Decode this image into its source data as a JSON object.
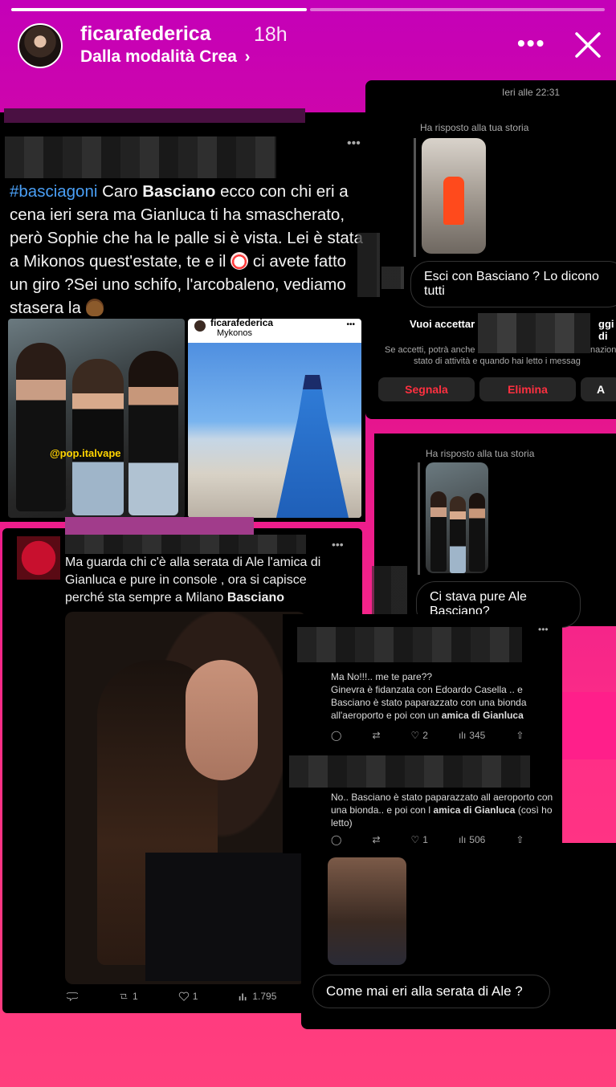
{
  "story": {
    "username": "ficarafederica",
    "time": "18h",
    "subtitle": "Dalla modalità Crea",
    "progress": [
      1.0,
      0.0
    ]
  },
  "dm1": {
    "timestamp": "Ieri alle 22:31",
    "reply_label": "Ha risposto alla tua storia",
    "message": "Esci con Basciano ? Lo dicono tutti",
    "request_title": "Vuoi accettar",
    "request_title_tail": "ggi di",
    "request_line1": "Se accetti, potrà anche",
    "request_line1_tail": "nazione",
    "request_line2": "stato di attività e quando hai letto i messag",
    "report_btn": "Segnala",
    "delete_btn": "Elimina",
    "accept_btn": "A"
  },
  "tweet1": {
    "hashtag": "#basciagoni",
    "text_a": " Caro ",
    "bold1": "Basciano",
    "text_b": " ecco con chi eri a cena ieri sera ma Gianluca ti ha smascherato, però Sophie che ha le palle si è vista. Lei è stata a Mikonos quest'estate, te e il ",
    "text_c": " ci avete fatto un giro ?Sei uno schifo, l'arcobaleno, vediamo stasera la ",
    "watermark": "@pop.italvape",
    "insta_user": "ficarafederica",
    "insta_place": "Mykonos"
  },
  "dm2": {
    "reply_label": "Ha risposto alla tua storia",
    "message": "Ci stava pure Ale Basciano?"
  },
  "tweet2": {
    "text": "Ma guarda chi c'è alla serata di Ale l'amica di Gianluca e pure in console , ora si capisce perché sta sempre a Milano ",
    "bold": "Basciano",
    "retweets": "1",
    "likes": "1",
    "views": "1.795"
  },
  "reply1": {
    "line1": "Ma No!!!.. me te pare??",
    "line2": "Ginevra è fidanzata con Edoardo Casella .. e Basciano è stato paparazzato con una bionda all'aeroporto e poi con un ",
    "bold": "amica di Gianluca",
    "likes": "2",
    "views": "345"
  },
  "reply2": {
    "text": "No.. Basciano è stato paparazzato all aeroporto con una bionda..  e poi con l ",
    "bold": "amica di Gianluca",
    "tail": " (così ho letto)",
    "likes": "1",
    "views": "506"
  },
  "dm3": {
    "message": "Come mai eri alla serata di Ale ?"
  },
  "colors": {
    "accent_red": "#ff3040",
    "hashtag_blue": "#4a9ff5",
    "bg_pink": "#e3128f"
  }
}
